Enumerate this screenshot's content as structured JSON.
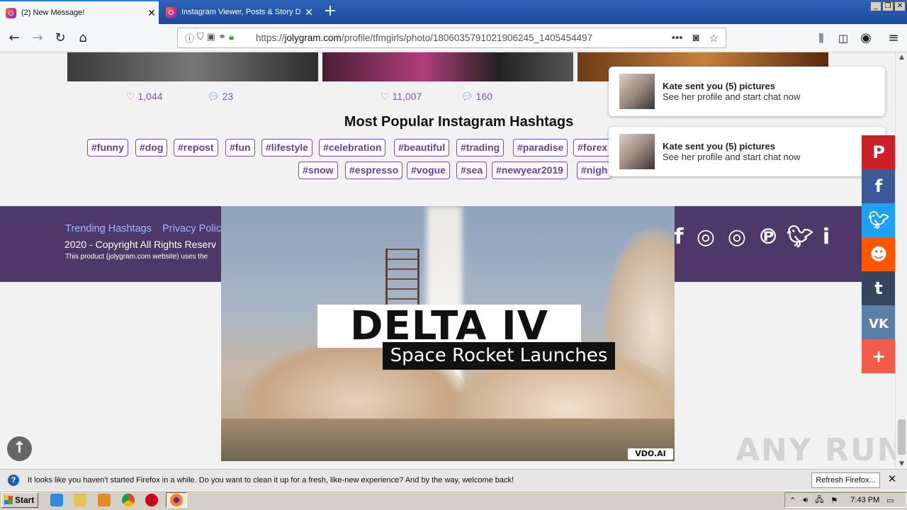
{
  "browser": {
    "tabs": [
      {
        "label": "(2) New Message!",
        "active": true
      },
      {
        "label": "Instagram Viewer, Posts & Story D",
        "active": false
      }
    ],
    "url_prefix": "https://",
    "url_domain": "jolygram.com",
    "url_path": "/profile/tfmgirls/photo/1806035791021906245_1405454497",
    "more_label": "•••"
  },
  "posts": [
    {
      "likes": "1,044",
      "comments": "23"
    },
    {
      "likes": "11,007",
      "comments": "160"
    }
  ],
  "hashtags": {
    "title": "Most Popular Instagram Hashtags",
    "row1": [
      "#funny",
      "#dog",
      "#repost",
      "#fun",
      "#lifestyle",
      "#celebration",
      "#beautiful",
      "#trading",
      "#paradise",
      "#forex"
    ],
    "row2": [
      "#snow",
      "#espresso",
      "#vogue",
      "#sea",
      "#newyear2019",
      "#nigh"
    ]
  },
  "footer": {
    "links": [
      "Trending Hashtags",
      "Privacy Polic"
    ],
    "copyright": "2020 - Copyright All Rights Reserv",
    "product_note": "This product (jolygram.com website) uses the"
  },
  "video_ad": {
    "title": "DELTA IV",
    "subtitle": "Space Rocket Launches",
    "badge": "VDO.AI"
  },
  "notifications": [
    {
      "title": "Kate sent you (5) pictures",
      "text": "See her profile and start chat now"
    },
    {
      "title": "Kate sent you (5) pictures",
      "text": "See her profile and start chat now"
    }
  ],
  "share_colors": {
    "pinterest": "#cb2027",
    "facebook": "#3b5998",
    "twitter": "#1da1f2",
    "reddit": "#ff5700",
    "tumblr": "#35465c",
    "vk": "#5b7fa6",
    "more": "#f25a4b"
  },
  "watermark": "ANY RUN",
  "notification_bar": {
    "message": "It looks like you haven't started Firefox in a while. Do you want to clean it up for a fresh, like-new experience? And by the way, welcome back!",
    "button": "Refresh Firefox..."
  },
  "taskbar": {
    "start": "Start",
    "clock": "7:43 PM"
  }
}
